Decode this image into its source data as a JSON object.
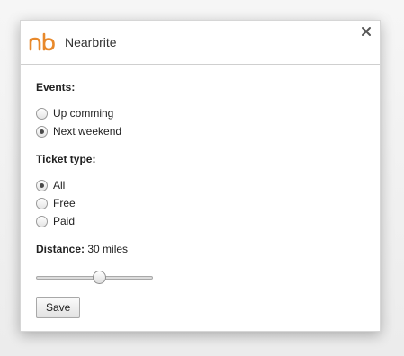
{
  "header": {
    "logo_text": "nb",
    "title": "Nearbrite",
    "close_label": "×"
  },
  "events": {
    "label": "Events:",
    "options": [
      {
        "label": "Up comming",
        "checked": false
      },
      {
        "label": "Next weekend",
        "checked": true
      }
    ]
  },
  "ticket_type": {
    "label": "Ticket type:",
    "options": [
      {
        "label": "All",
        "checked": true
      },
      {
        "label": "Free",
        "checked": false
      },
      {
        "label": "Paid",
        "checked": false
      }
    ]
  },
  "distance": {
    "label": "Distance:",
    "value_text": "30 miles",
    "slider_fraction": 0.55
  },
  "save_label": "Save",
  "colors": {
    "brand": "#e8892b",
    "close": "#555555"
  }
}
